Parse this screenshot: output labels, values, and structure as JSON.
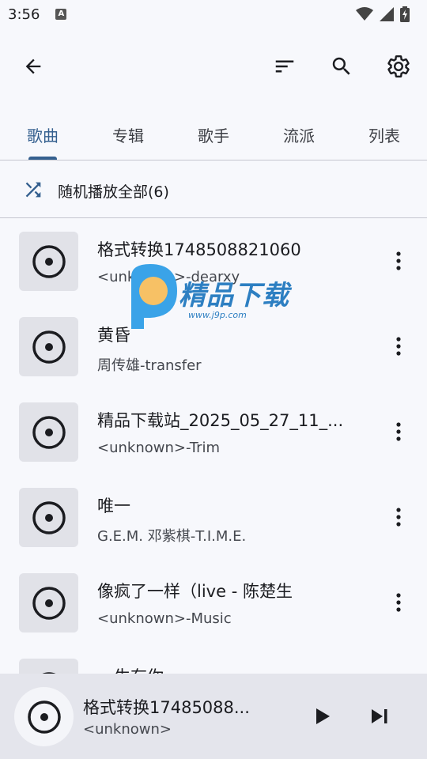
{
  "status_bar": {
    "time": "3:56",
    "notification_icon": "a-icon"
  },
  "app_bar": {
    "back_icon": "arrow-back-icon",
    "sort_icon": "sort-icon",
    "search_icon": "search-icon",
    "settings_icon": "gear-icon"
  },
  "tabs": [
    {
      "label": "歌曲",
      "active": true
    },
    {
      "label": "专辑",
      "active": false
    },
    {
      "label": "歌手",
      "active": false
    },
    {
      "label": "流派",
      "active": false
    },
    {
      "label": "列表",
      "active": false
    }
  ],
  "shuffle": {
    "label": "随机播放全部(6)",
    "icon": "shuffle-icon"
  },
  "songs": [
    {
      "title": "格式转换1748508821060",
      "subtitle": "<unknown>-dearxy"
    },
    {
      "title": "黄昏",
      "subtitle": "周传雄-transfer"
    },
    {
      "title": "精品下载站_2025_05_27_11_...",
      "subtitle": "<unknown>-Trim"
    },
    {
      "title": "唯一",
      "subtitle": "G.E.M. 邓紫棋-T.I.M.E."
    },
    {
      "title": "像疯了一样（live  - 陈楚生",
      "subtitle": "<unknown>-Music"
    },
    {
      "title": "一生有你",
      "subtitle": ""
    }
  ],
  "watermark": {
    "brand": "精品下载",
    "url": "www.j9p.com"
  },
  "mini_player": {
    "title": "格式转换17485088...",
    "subtitle": "<unknown>",
    "play_icon": "play-icon",
    "next_icon": "skip-next-icon"
  },
  "colors": {
    "accent": "#35608f",
    "background": "#f7f8fc",
    "cover_bg": "#e1e2e8"
  }
}
